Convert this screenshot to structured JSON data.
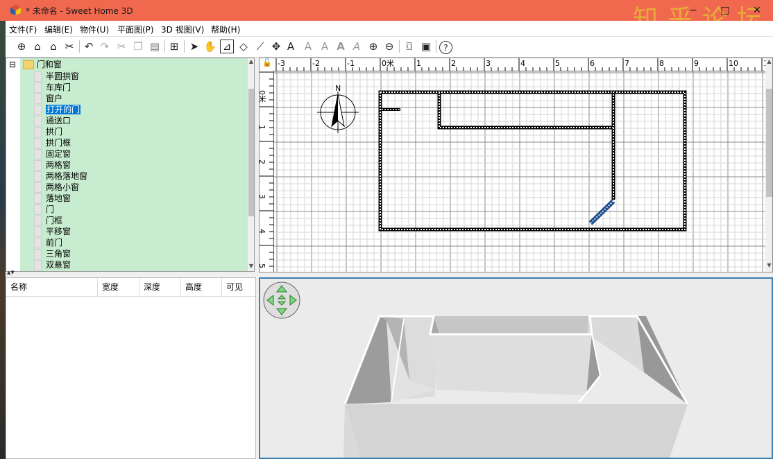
{
  "window": {
    "title": "* 未命名 - Sweet Home 3D",
    "watermark": "知乎论坛",
    "title_bar_color": "#f0694f",
    "minimize_glyph": "−",
    "maximize_glyph": "□",
    "close_glyph": "✕"
  },
  "menubar": {
    "items": [
      "文件(F)",
      "编辑(E)",
      "物件(U)",
      "平面图(P)",
      "3D 视图(V)",
      "帮助(H)"
    ]
  },
  "toolbar": {
    "buttons": [
      "new-home",
      "open",
      "save",
      "preferences",
      "undo",
      "redo",
      "cut",
      "copy",
      "paste",
      "add-furniture",
      "select-mode",
      "pan-mode",
      "create-walls",
      "create-rooms",
      "create-polylines",
      "create-dimensions",
      "add-text",
      "increase-text-size",
      "decrease-text-size",
      "bold",
      "italic",
      "zoom-in",
      "zoom-out",
      "create-photo",
      "create-video",
      "help"
    ],
    "selected": "create-walls"
  },
  "catalog": {
    "category": "门和窗",
    "expand_glyph": "⊟",
    "selected_item": "打开的门",
    "items": [
      "半圆拱窗",
      "车库门",
      "窗户",
      "打开的门",
      "通送口",
      "拱门",
      "拱门框",
      "固定窗",
      "两格窗",
      "两格落地窗",
      "两格小窗",
      "落地窗",
      "门",
      "门框",
      "平移窗",
      "前门",
      "三角窗",
      "双悬窗"
    ]
  },
  "furniture_table": {
    "columns": [
      "名称",
      "宽度",
      "深度",
      "高度",
      "可见"
    ]
  },
  "plan": {
    "ruler_x_labels": [
      "-3",
      "-2",
      "-1",
      "0米",
      "1",
      "2",
      "3",
      "4",
      "5",
      "6",
      "7",
      "8",
      "9",
      "10",
      "1"
    ],
    "ruler_y_labels": [
      "0米",
      "1",
      "2",
      "3",
      "4",
      "5"
    ],
    "compass_label": "N",
    "unit": "米"
  },
  "colors": {
    "catalog_bg": "#c8ecd0",
    "selection": "#0078d7",
    "view3d_border": "#3c7fb1"
  }
}
